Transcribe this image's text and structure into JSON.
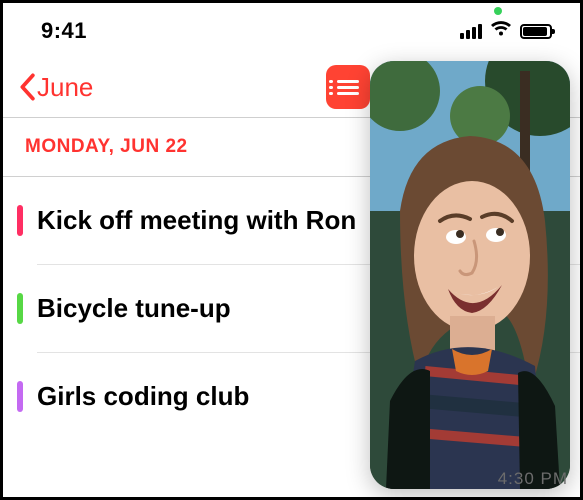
{
  "statusbar": {
    "time": "9:41"
  },
  "navbar": {
    "back_label": "June",
    "list_button": "list-view"
  },
  "date_header": "MONDAY, JUN 22",
  "events": [
    {
      "label": "Kick off meeting with Ron",
      "color": "#ff2f63"
    },
    {
      "label": "Bicycle tune-up",
      "color": "#57d845"
    },
    {
      "label": "Girls coding club",
      "color": "#c46af2"
    }
  ],
  "pip": {
    "subject": "person-looking-up",
    "timestamp_overlay": "4:30 PM"
  }
}
